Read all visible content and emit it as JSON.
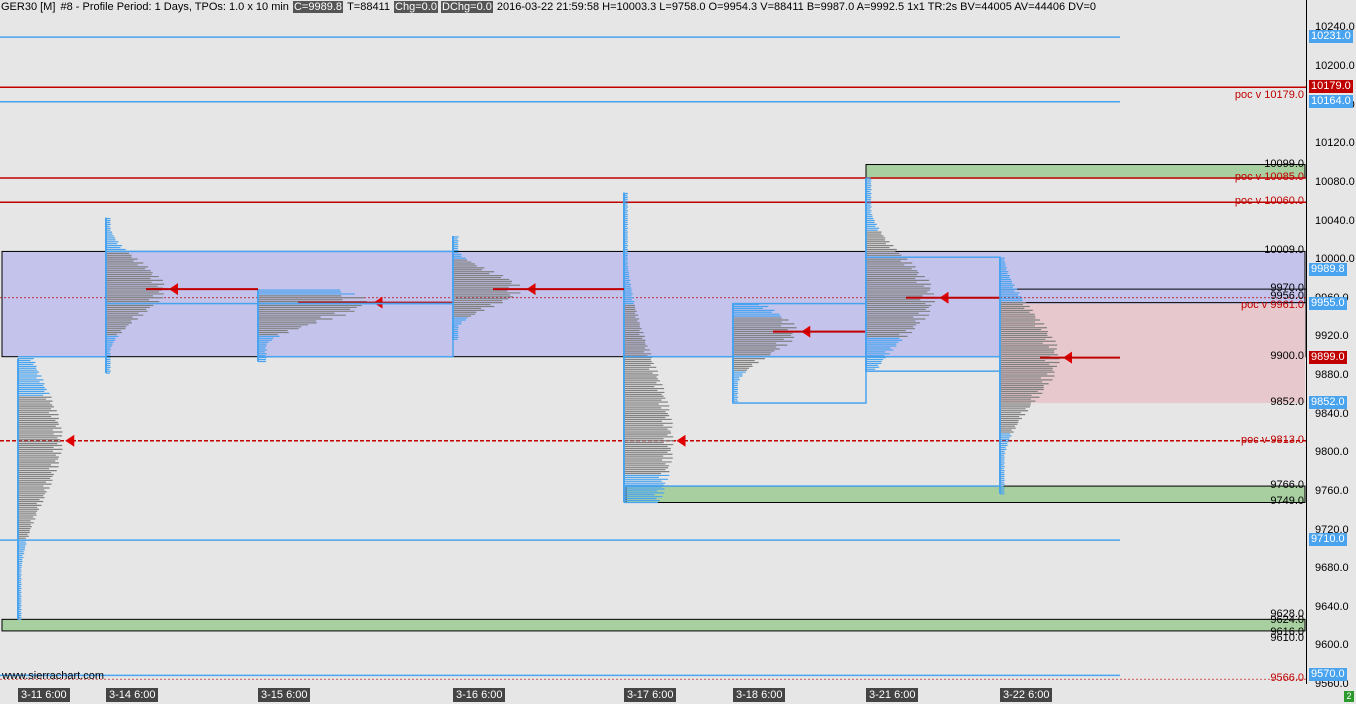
{
  "header": {
    "symbol": "GER30 [M]",
    "chart_no": "#8 - Profile Period: 1 Days, TPOs: 1.0 x 10 min",
    "close": "C=9989.8",
    "trades": "T=88411",
    "chg": "Chg=0.0",
    "dchg": "DChg=0.0",
    "stats": "2016-03-22 21:59:58 H=10003.3 L=9758.0 O=9954.3 V=88411 B=9987.0 A=9992.5 1x1 TR:2s BV=44005 AV=44406 DV=0"
  },
  "price_axis": {
    "ticks": [
      "10240.0",
      "10200.0",
      "10160.0",
      "10120.0",
      "10080.0",
      "10040.0",
      "10000.0",
      "9960.0",
      "9920.0",
      "9880.0",
      "9840.0",
      "9800.0",
      "9760.0",
      "9720.0",
      "9680.0",
      "9640.0",
      "9600.0",
      "9560.0"
    ],
    "tags": [
      {
        "text": "10231.0",
        "color": "#4aa3ef",
        "price": 10231
      },
      {
        "text": "10179.0",
        "color": "#c00000",
        "price": 10179
      },
      {
        "text": "10164.0",
        "color": "#4aa3ef",
        "price": 10164
      },
      {
        "text": "9989.8",
        "color": "#4aa3ef",
        "price": 9989.8
      },
      {
        "text": "9955.0",
        "color": "#4aa3ef",
        "price": 9955
      },
      {
        "text": "9899.0",
        "color": "#c00000",
        "price": 9899
      },
      {
        "text": "9852.0",
        "color": "#4aa3ef",
        "price": 9852
      },
      {
        "text": "9710.0",
        "color": "#4aa3ef",
        "price": 9710
      },
      {
        "text": "9570.0",
        "color": "#4aa3ef",
        "price": 9570
      }
    ]
  },
  "level_labels": [
    {
      "text": "poc v  10179.0",
      "color": "#c00000",
      "price": 10170
    },
    {
      "text": "10099.0",
      "color": "#000",
      "price": 10099
    },
    {
      "text": "poc v  10085.0",
      "color": "#c00000",
      "price": 10085
    },
    {
      "text": "poc v  10060.0",
      "color": "#c00000",
      "price": 10060
    },
    {
      "text": "10009.0",
      "color": "#000",
      "price": 10009
    },
    {
      "text": "9970.0",
      "color": "#000",
      "price": 9970
    },
    {
      "text": "9956.0",
      "color": "#000",
      "price": 9962
    },
    {
      "text": "poc v  9961.0",
      "color": "#c00000",
      "price": 9952
    },
    {
      "text": "9900.0",
      "color": "#000",
      "price": 9900
    },
    {
      "text": "9852.0",
      "color": "#000",
      "price": 9852
    },
    {
      "text": "poc v  9813.0",
      "color": "#c00000",
      "price": 9813
    },
    {
      "text": "9766.0",
      "color": "#000",
      "price": 9766
    },
    {
      "text": "9749.0",
      "color": "#000",
      "price": 9749
    },
    {
      "text": "9628.0",
      "color": "#000",
      "price": 9633
    },
    {
      "text": "9624.0",
      "color": "#000",
      "price": 9626
    },
    {
      "text": "9616.0",
      "color": "#000",
      "price": 9614
    },
    {
      "text": "9610.0",
      "color": "#000",
      "price": 9608
    },
    {
      "text": "9566.0",
      "color": "#c00000",
      "price": 9566
    }
  ],
  "time_axis": {
    "labels": [
      "3-11  6:00",
      "3-14  6:00",
      "3-15  6:00",
      "3-16  6:00",
      "3-17  6:00",
      "3-18  6:00",
      "3-21  6:00",
      "3-22  6:00"
    ]
  },
  "watermark": "www.sierrachart.com",
  "corner_badge": "2",
  "colors": {
    "blue": "#4aa3ef",
    "red": "#c00000",
    "gray": "#808080",
    "value_area": "#c3c3ec",
    "green_zone": "#a8cfa0",
    "pink_zone": "#e7c8cc"
  },
  "chart_data": {
    "type": "market-profile",
    "title": "GER30 [M] #8 - Profile Period: 1 Days, TPOs: 1.0 x 10 min",
    "price_range": [
      9545,
      10255
    ],
    "sessions": [
      {
        "date": "3-11  6:00",
        "high": 9898,
        "low": 9628,
        "poc": 9813
      },
      {
        "date": "3-14  6:00",
        "high": 10044,
        "low": 9883,
        "poc": 9970
      },
      {
        "date": "3-15  6:00",
        "high": 9970,
        "low": 9895,
        "poc": 9956
      },
      {
        "date": "3-16  6:00",
        "high": 10025,
        "low": 9918,
        "poc": 9970
      },
      {
        "date": "3-17  6:00",
        "high": 10070,
        "low": 9749,
        "poc": 9813
      },
      {
        "date": "3-18  6:00",
        "high": 9955,
        "low": 9852,
        "poc": 9926
      },
      {
        "date": "3-21  6:00",
        "high": 10085,
        "low": 9885,
        "poc": 9961
      },
      {
        "date": "3-22  6:00",
        "high": 10003,
        "low": 9758,
        "poc": 9899
      }
    ],
    "horizontal_levels": [
      10231,
      10179,
      10164,
      10085,
      10060,
      10009,
      9955,
      9900,
      9813,
      9766,
      9749,
      9710,
      9628,
      9616,
      9570,
      9566
    ]
  }
}
